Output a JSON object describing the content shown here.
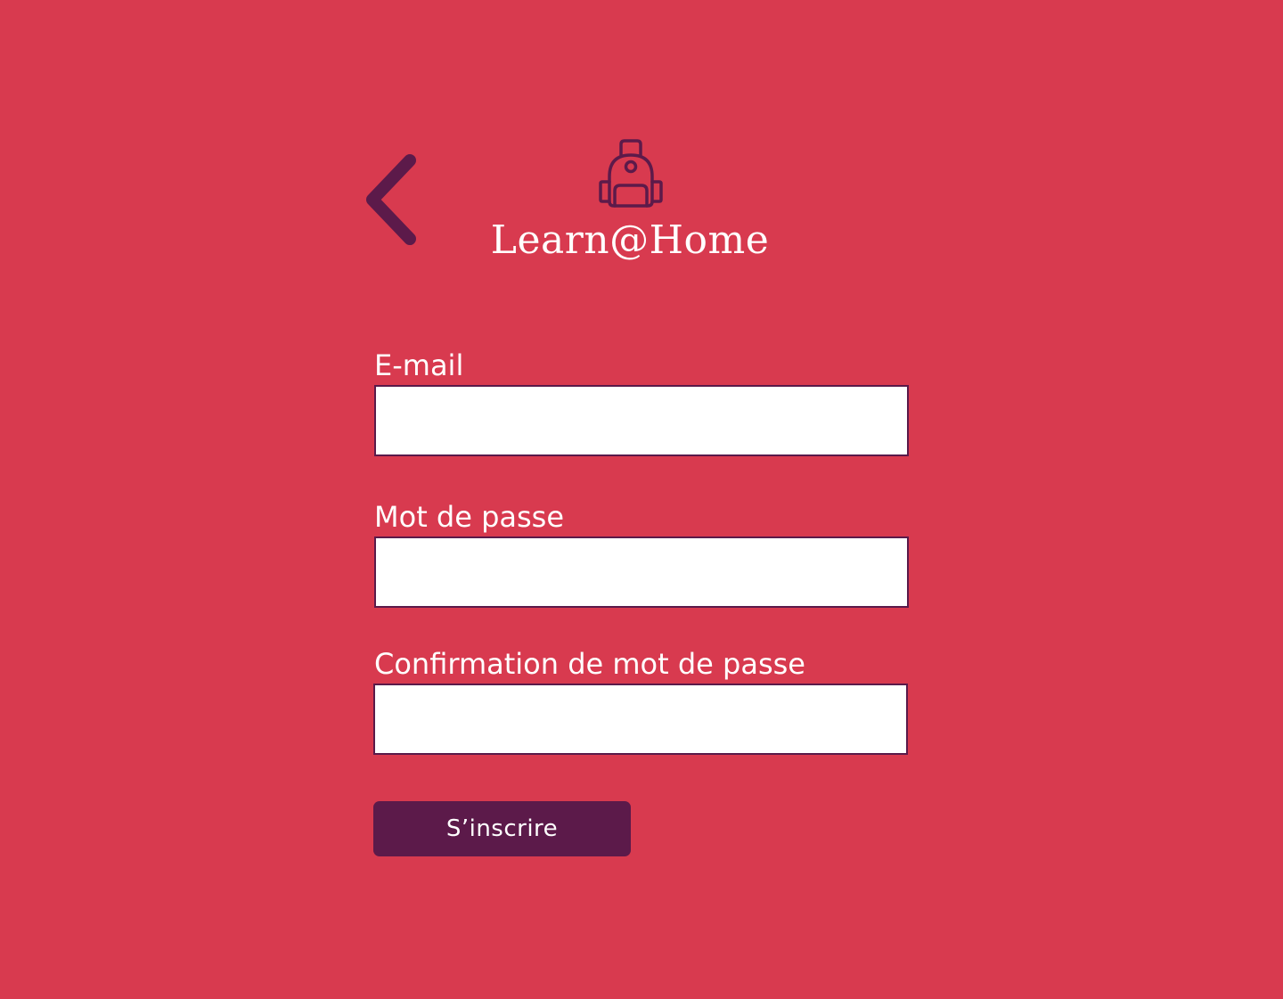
{
  "header": {
    "back_icon": "chevron-left-icon",
    "logo_icon": "backpack-icon",
    "brand_name": "Learn@Home"
  },
  "form": {
    "email": {
      "label": "E-mail",
      "value": "",
      "placeholder": ""
    },
    "password": {
      "label": "Mot de passe",
      "value": "",
      "placeholder": ""
    },
    "confirm_password": {
      "label": "Confirmation de mot de passe",
      "value": "",
      "placeholder": ""
    },
    "submit_label": "S’inscrire"
  },
  "colors": {
    "background": "#D83A4F",
    "accent": "#5C1A4A",
    "text": "#FFFFFF",
    "input_background": "#FFFFFF"
  }
}
